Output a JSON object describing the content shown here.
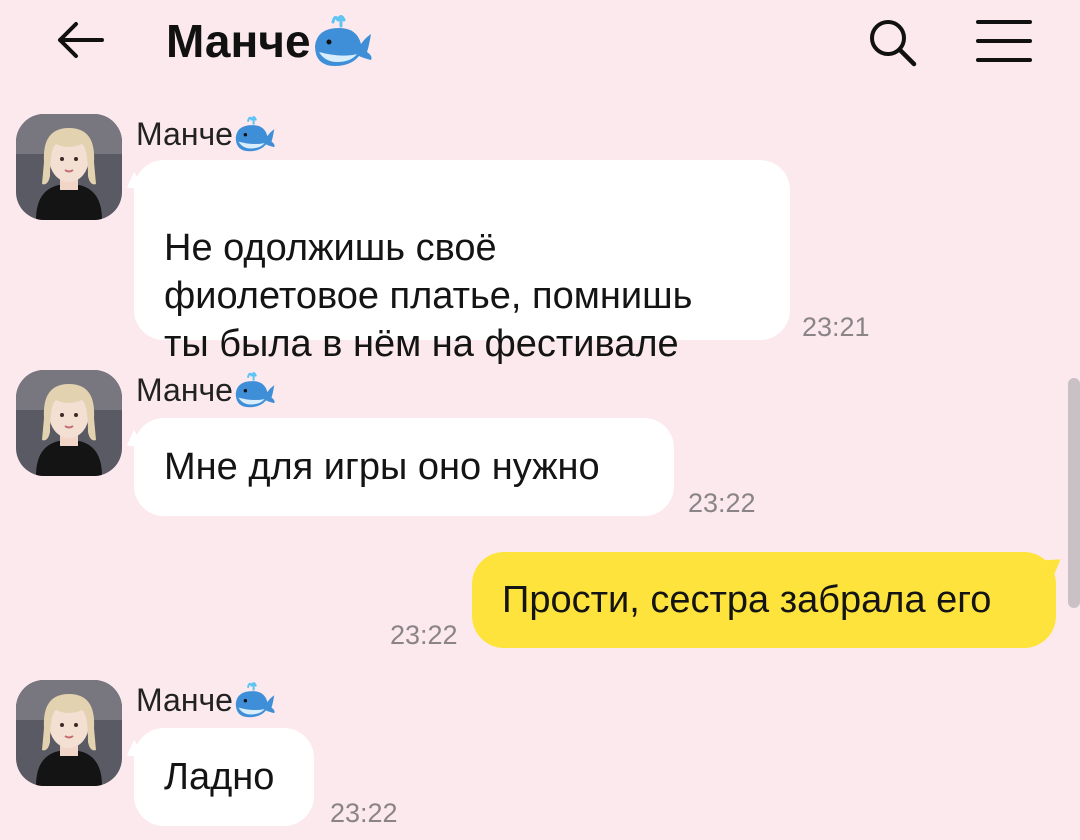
{
  "header": {
    "title": "Манче",
    "title_icon": "whale-emoji",
    "back_icon": "arrow-left-icon",
    "search_icon": "search-icon",
    "menu_icon": "hamburger-menu-icon"
  },
  "messages": [
    {
      "direction": "incoming",
      "sender": "Манче",
      "text": "Не одолжишь своё\nфиолетовое платье, помнишь\nты была в нём на фестивале",
      "time": "23:21"
    },
    {
      "direction": "incoming",
      "sender": "Манче",
      "text": "Мне для игры оно нужно",
      "time": "23:22"
    },
    {
      "direction": "outgoing",
      "text": "Прости, сестра забрала его",
      "time": "23:22"
    },
    {
      "direction": "incoming",
      "sender": "Манче",
      "text": "Ладно",
      "time": "23:22"
    }
  ],
  "colors": {
    "background": "#fce9ee",
    "incoming_bubble": "#ffffff",
    "outgoing_bubble": "#fee33c",
    "timestamp": "#8a8488"
  }
}
